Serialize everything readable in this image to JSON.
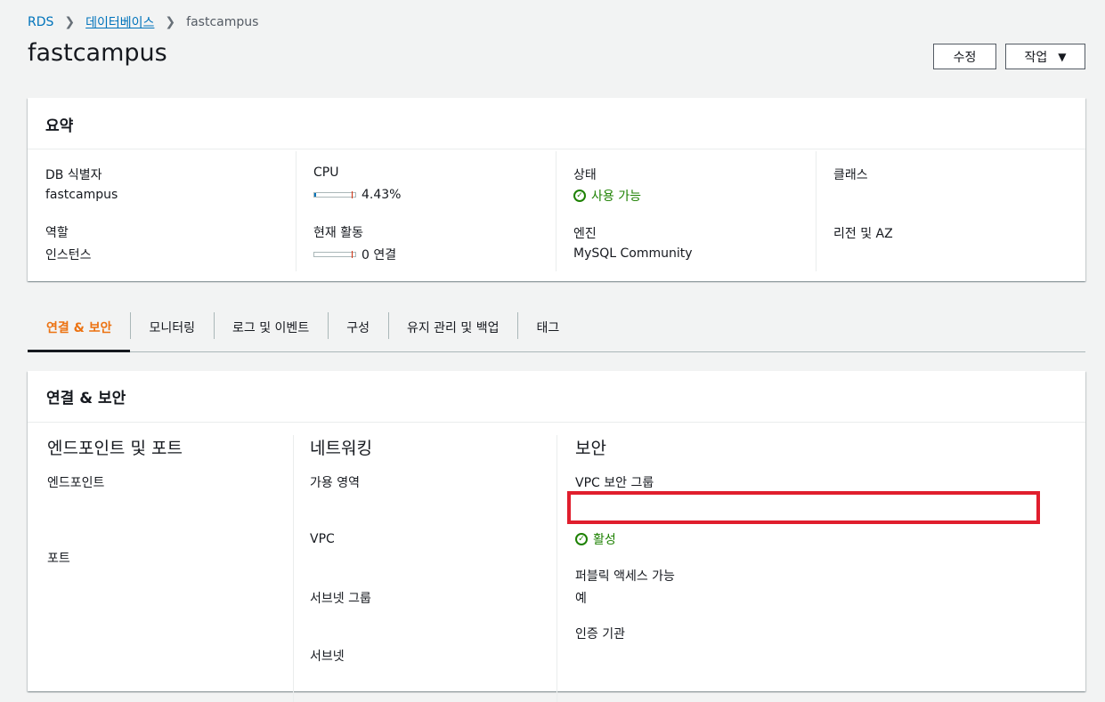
{
  "breadcrumb": {
    "root": "RDS",
    "databases": "데이터베이스",
    "current": "fastcampus"
  },
  "page_title": "fastcampus",
  "buttons": {
    "edit": "수정",
    "actions": "작업"
  },
  "summary": {
    "title": "요약",
    "db_identifier_label": "DB 식별자",
    "db_identifier": "fastcampus",
    "role_label": "역할",
    "role": "인스턴스",
    "cpu_label": "CPU",
    "cpu_value": "4.43%",
    "cpu_fraction": 0.0443,
    "activity_label": "현재 활동",
    "activity_value": "0 연결",
    "status_label": "상태",
    "status_value": "사용 가능",
    "engine_label": "엔진",
    "engine_value": "MySQL Community",
    "class_label": "클래스",
    "region_label": "리전 및 AZ"
  },
  "tabs": [
    "연결 & 보안",
    "모니터링",
    "로그 및 이벤트",
    "구성",
    "유지 관리 및 백업",
    "태그"
  ],
  "connectivity": {
    "title": "연결 & 보안",
    "endpoint_section": "엔드포인트 및 포트",
    "endpoint_label": "엔드포인트",
    "port_label": "포트",
    "network_section": "네트워킹",
    "az_label": "가용 영역",
    "vpc_label": "VPC",
    "subnet_group_label": "서브넷 그룹",
    "subnet_label": "서브넷",
    "security_section": "보안",
    "vpc_sg_label": "VPC 보안 그룹",
    "sg_status": "활성",
    "public_access_label": "퍼블릭 액세스 가능",
    "public_access_value": "예",
    "ca_label": "인증 기관"
  },
  "colors": {
    "accent": "#ec7211",
    "link": "#0073bb",
    "success": "#1d8102",
    "highlight": "#e01e2d"
  }
}
